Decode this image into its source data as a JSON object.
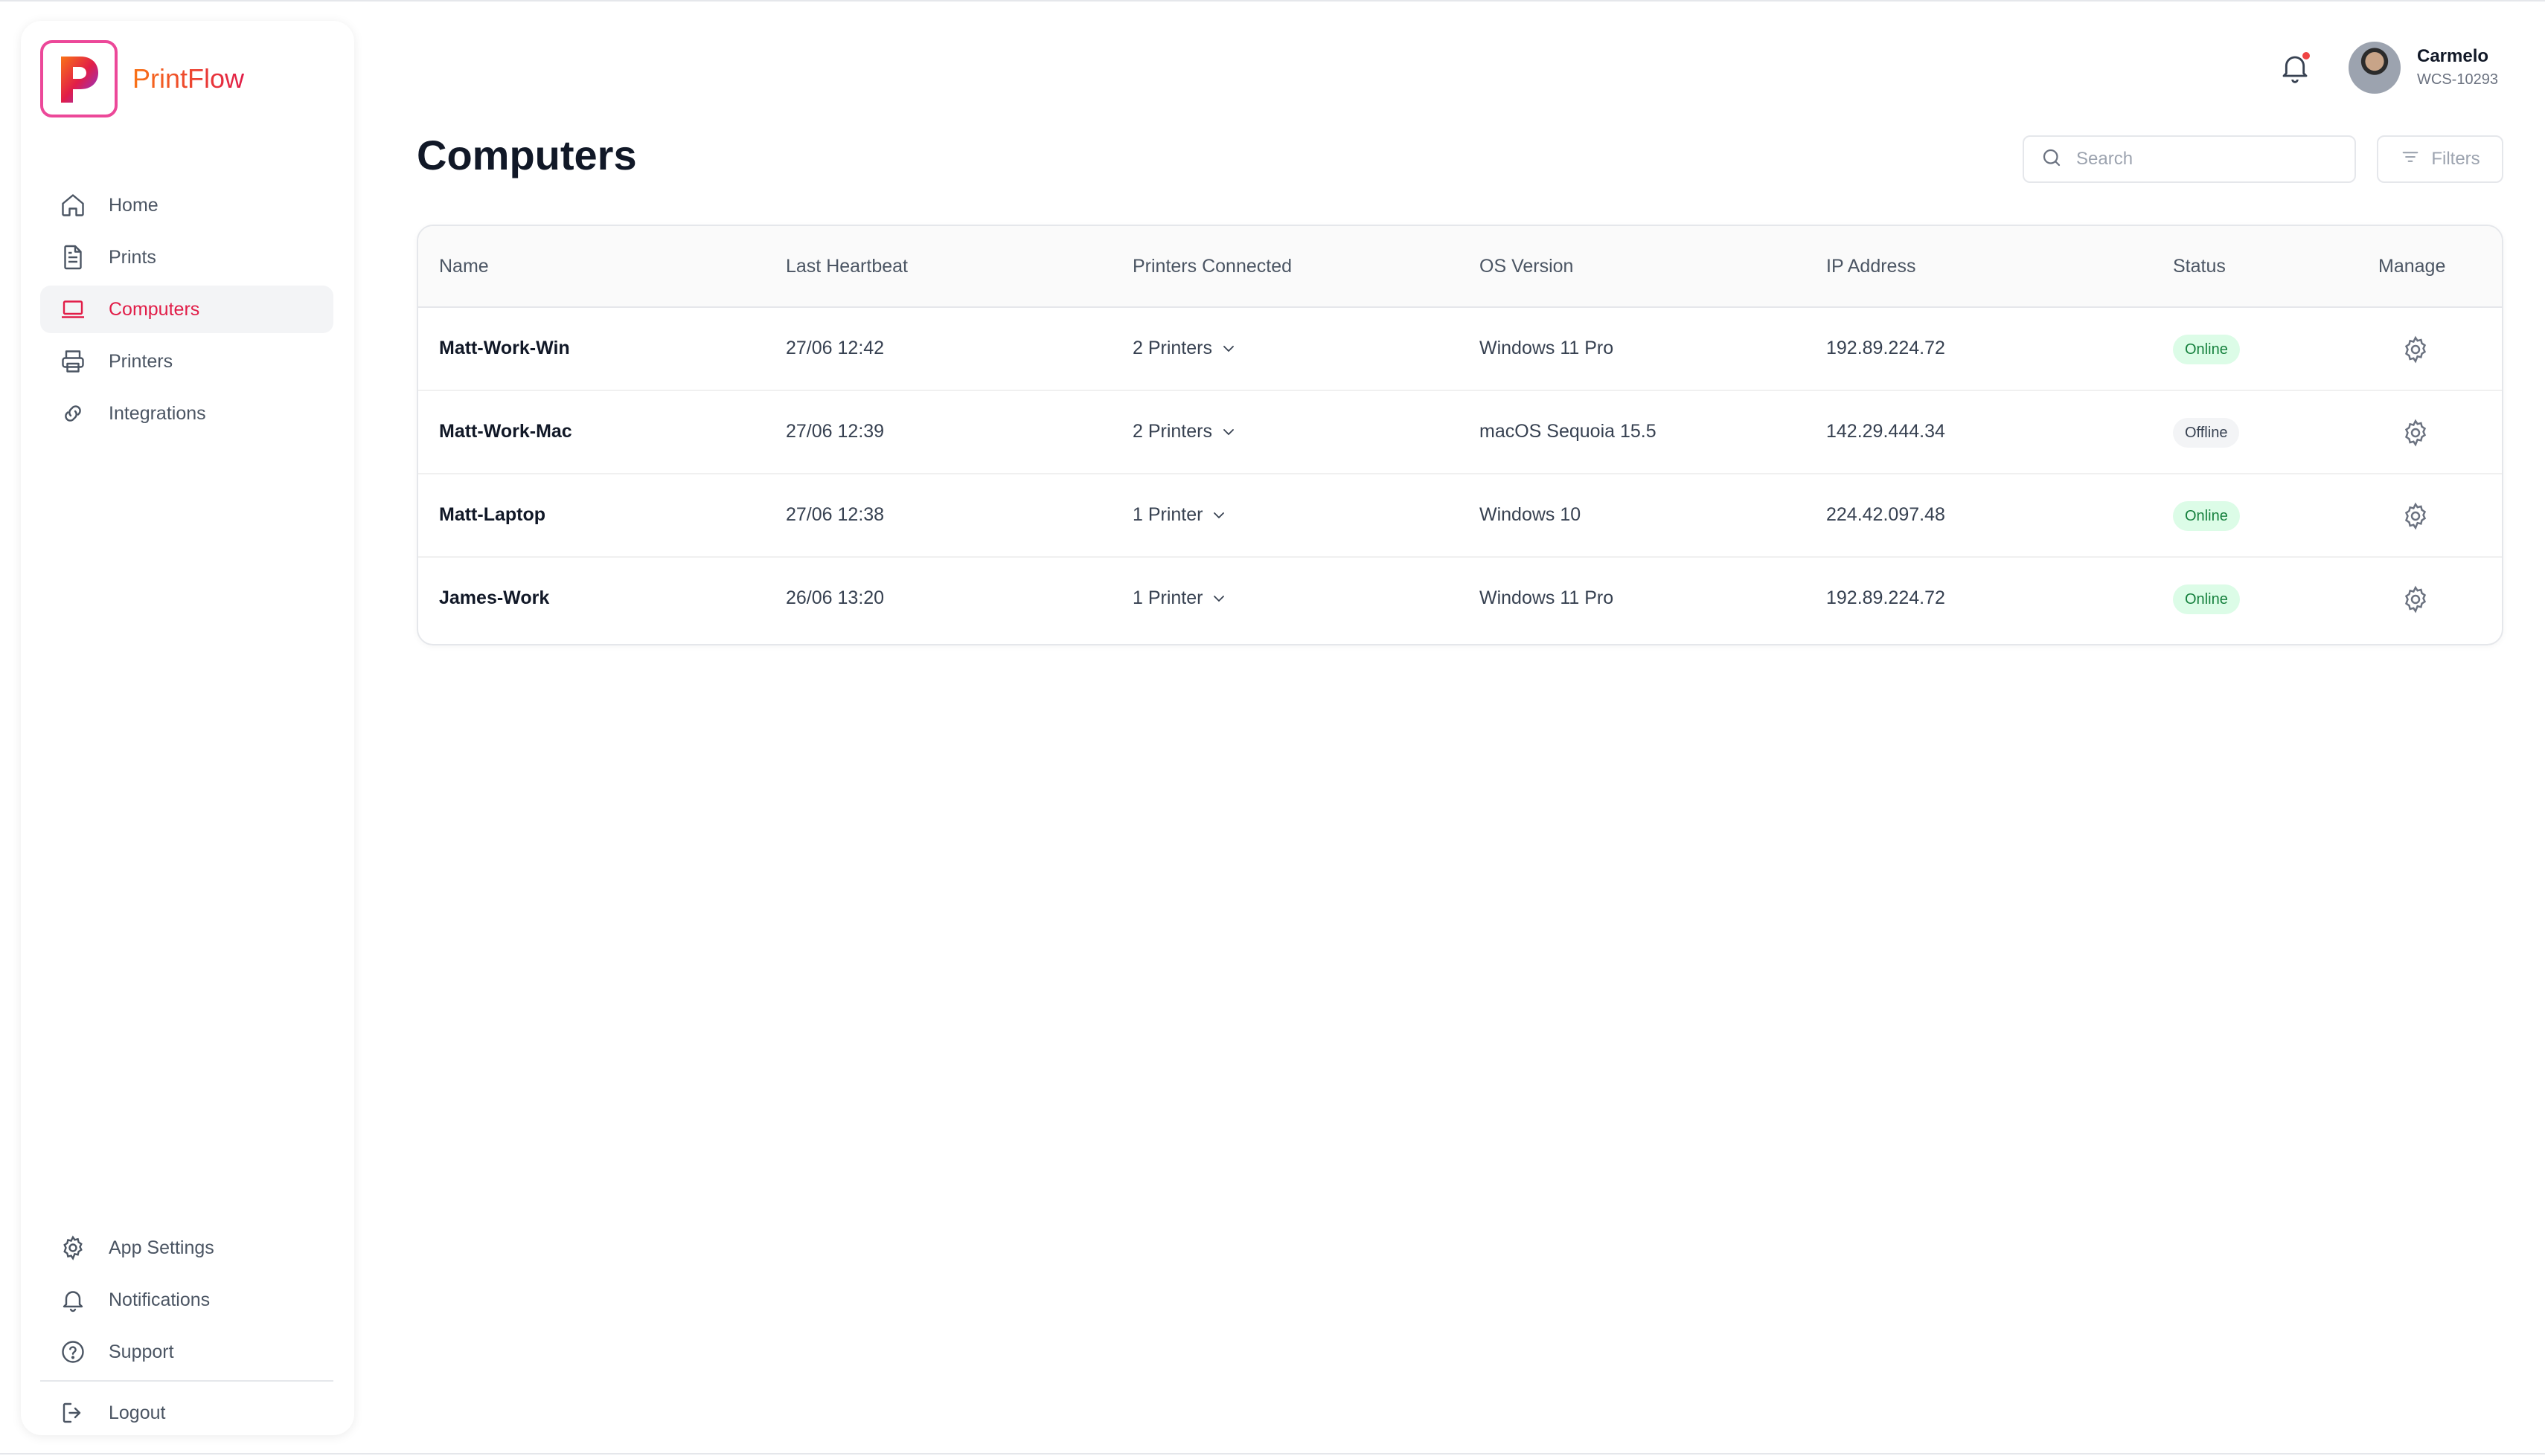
{
  "app": {
    "name": "PrintFlow",
    "logo_letter": "P"
  },
  "sidebar": {
    "items": [
      {
        "label": "Home",
        "icon": "home-icon",
        "active": false
      },
      {
        "label": "Prints",
        "icon": "document-icon",
        "active": false
      },
      {
        "label": "Computers",
        "icon": "laptop-icon",
        "active": true
      },
      {
        "label": "Printers",
        "icon": "printer-icon",
        "active": false
      },
      {
        "label": "Integrations",
        "icon": "link-icon",
        "active": false
      }
    ],
    "bottom_items": [
      {
        "label": "App Settings",
        "icon": "gear-icon"
      },
      {
        "label": "Notifications",
        "icon": "bell-icon"
      },
      {
        "label": "Support",
        "icon": "help-circle-icon"
      }
    ],
    "logout": {
      "label": "Logout",
      "icon": "logout-icon"
    }
  },
  "header": {
    "notification_icon": "bell-icon",
    "has_unread": true,
    "user": {
      "name": "Carmelo",
      "id": "WCS-10293"
    }
  },
  "page": {
    "title": "Computers",
    "search": {
      "placeholder": "Search",
      "value": ""
    },
    "filters_label": "Filters"
  },
  "table": {
    "columns": [
      "Name",
      "Last Heartbeat",
      "Printers Connected",
      "OS Version",
      "IP Address",
      "Status",
      "Manage"
    ],
    "rows": [
      {
        "name": "Matt-Work-Win",
        "last_heartbeat": "27/06 12:42",
        "printers": "2 Printers",
        "os": "Windows 11 Pro",
        "ip": "192.89.224.72",
        "status": "Online"
      },
      {
        "name": "Matt-Work-Mac",
        "last_heartbeat": "27/06 12:39",
        "printers": "2 Printers",
        "os": "macOS Sequoia 15.5",
        "ip": "142.29.444.34",
        "status": "Offline"
      },
      {
        "name": "Matt-Laptop",
        "last_heartbeat": "27/06 12:38",
        "printers": "1 Printer",
        "os": "Windows 10",
        "ip": "224.42.097.48",
        "status": "Online"
      },
      {
        "name": "James-Work",
        "last_heartbeat": "26/06 13:20",
        "printers": "1 Printer",
        "os": "Windows 11 Pro",
        "ip": "192.89.224.72",
        "status": "Online"
      }
    ]
  },
  "colors": {
    "accent": "#e11d48",
    "online_bg": "#dcfce7",
    "online_text": "#15803d",
    "offline_bg": "#f3f4f6"
  }
}
